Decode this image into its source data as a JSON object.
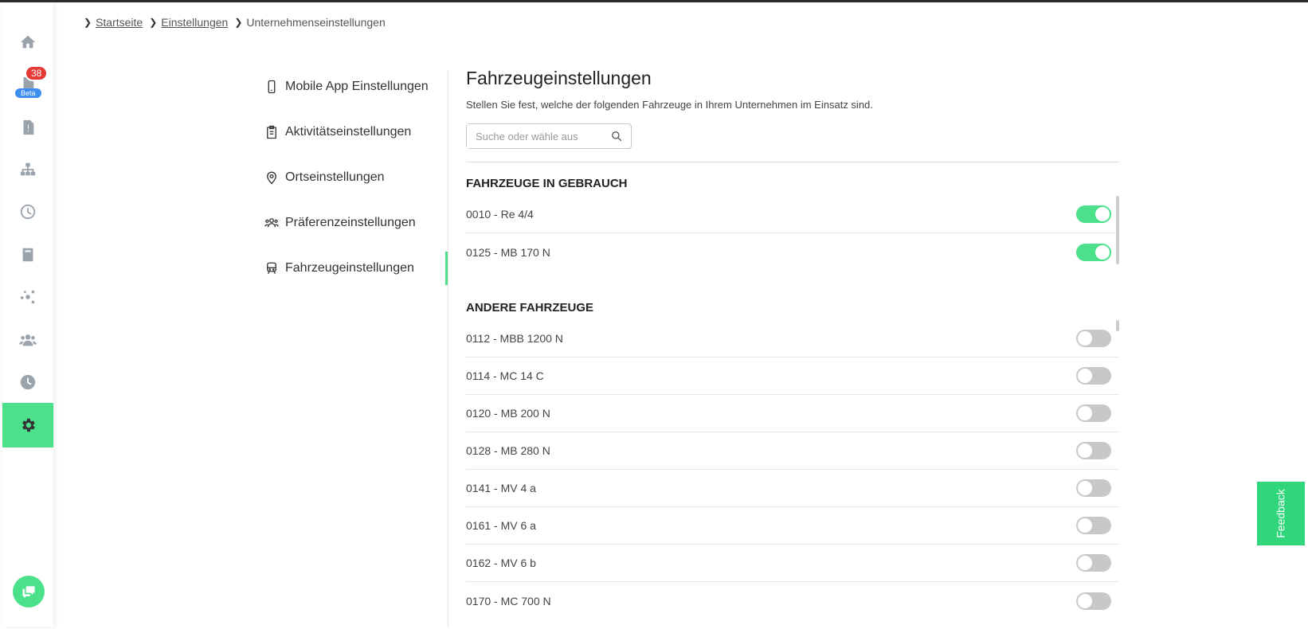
{
  "sidebar": {
    "badge_count": "38",
    "badge_beta": "Beta",
    "items": [
      "home-icon",
      "documents-icon",
      "report-icon",
      "network-icon",
      "clock-icon",
      "book-icon",
      "connections-icon",
      "team-icon",
      "history-icon",
      "settings-icon"
    ]
  },
  "breadcrumb": {
    "items": [
      "Startseite",
      "Einstellungen",
      "Unternehmenseinstellungen"
    ]
  },
  "subnav": {
    "items": [
      "Mobile App Einstellungen",
      "Aktivitätseinstellungen",
      "Ortseinstellungen",
      "Präferenzeinstellungen",
      "Fahrzeugeinstellungen"
    ]
  },
  "content": {
    "title": "Fahrzeugeinstellungen",
    "subtitle": "Stellen Sie fest, welche der folgenden Fahrzeuge in Ihrem Unternehmen im Einsatz sind.",
    "search_placeholder": "Suche oder wähle aus",
    "in_use_title": "FAHRZEUGE IN GEBRAUCH",
    "in_use": [
      {
        "label": "0010 - Re 4/4",
        "enabled": true
      },
      {
        "label": "0125 - MB 170 N",
        "enabled": true
      }
    ],
    "other_title": "ANDERE FAHRZEUGE",
    "other": [
      {
        "label": "0112 - MBB 1200 N",
        "enabled": false
      },
      {
        "label": "0114 - MC 14 C",
        "enabled": false
      },
      {
        "label": "0120 - MB 200 N",
        "enabled": false
      },
      {
        "label": "0128 - MB 280 N",
        "enabled": false
      },
      {
        "label": "0141 - MV 4 a",
        "enabled": false
      },
      {
        "label": "0161 - MV 6 a",
        "enabled": false
      },
      {
        "label": "0162 - MV 6 b",
        "enabled": false
      },
      {
        "label": "0170 - MC 700 N",
        "enabled": false
      }
    ]
  },
  "feedback": "Feedback",
  "colors": {
    "accent": "#4be08a",
    "badge": "#e53935",
    "beta": "#3d8ef0"
  }
}
